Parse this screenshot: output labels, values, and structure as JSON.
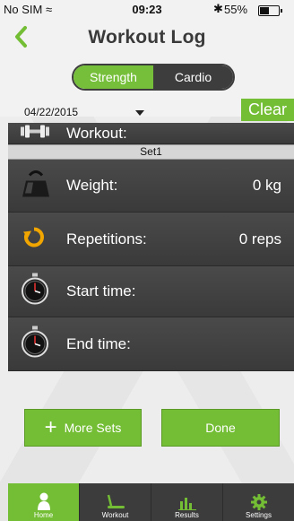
{
  "status_bar": {
    "carrier": "No SIM",
    "time": "09:23",
    "battery_text": "55%",
    "battery_level": 0.55
  },
  "nav": {
    "title": "Workout Log",
    "back_icon": "chevron-left-icon"
  },
  "segment": {
    "strength": "Strength",
    "cardio": "Cardio",
    "selected": "Strength"
  },
  "date": {
    "value": "04/22/2015"
  },
  "clear_label": "Clear",
  "workout_row": {
    "label": "Workout:",
    "icon": "dumbbell-icon"
  },
  "set_header": "Set1",
  "weight_row": {
    "label": "Weight:",
    "value": "0 kg",
    "icon": "kettlebell-icon"
  },
  "reps_row": {
    "label": "Repetitions:",
    "value": "0 reps",
    "icon": "refresh-icon"
  },
  "start_row": {
    "label": "Start time:",
    "icon": "stopwatch-icon"
  },
  "end_row": {
    "label": "End time:",
    "icon": "stopwatch-icon"
  },
  "buttons": {
    "more_sets": "More Sets",
    "done": "Done"
  },
  "tabs": [
    {
      "label": "Home",
      "icon": "person-icon",
      "active": true
    },
    {
      "label": "Workout",
      "icon": "treadmill-icon",
      "active": false
    },
    {
      "label": "Results",
      "icon": "bar-chart-icon",
      "active": false
    },
    {
      "label": "Settings",
      "icon": "gear-icon",
      "active": false
    }
  ],
  "colors": {
    "accent": "#74be35",
    "row_bg": "#444444",
    "tab_bg": "#3c3c3c"
  }
}
